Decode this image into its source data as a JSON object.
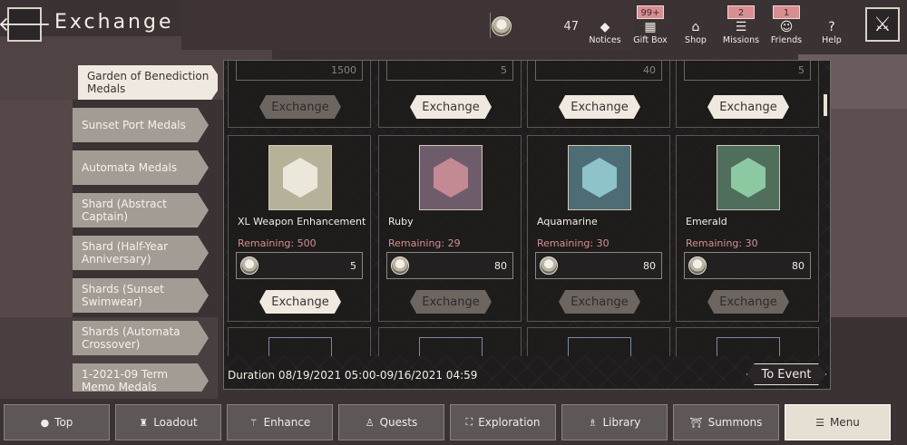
{
  "header": {
    "title": "Exchange",
    "currency_count": "47",
    "nav": [
      {
        "label": "Notices",
        "glyph": "◆",
        "badge": ""
      },
      {
        "label": "Gift Box",
        "glyph": "▦",
        "badge": "99+"
      },
      {
        "label": "Shop",
        "glyph": "⌂",
        "badge": ""
      },
      {
        "label": "Missions",
        "glyph": "☰",
        "badge": "2"
      },
      {
        "label": "Friends",
        "glyph": "☺",
        "badge": "1"
      },
      {
        "label": "Help",
        "glyph": "?",
        "badge": ""
      }
    ]
  },
  "categories": [
    "Garden of Benediction Medals",
    "Sunset Port Medals",
    "Automata Medals",
    "Shard (Abstract Captain)",
    "Shard (Half-Year Anniversary)",
    "Shards (Sunset Swimwear)",
    "Shards (Automata Crossover)",
    "1-2021-09 Term Memo Medals"
  ],
  "partial_row": [
    {
      "cost": "1500",
      "button": "Exchange"
    },
    {
      "cost": "5",
      "button": "Exchange"
    },
    {
      "cost": "40",
      "button": "Exchange"
    },
    {
      "cost": "5",
      "button": "Exchange"
    }
  ],
  "items": [
    {
      "name": "XL Weapon Enhancement",
      "remaining": "Remaining: 500",
      "cost": "5",
      "button": "Exchange",
      "color": "#e9e6dc"
    },
    {
      "name": "Ruby",
      "remaining": "Remaining: 29",
      "cost": "80",
      "button": "Exchange",
      "color": "#c48a94"
    },
    {
      "name": "Aquamarine",
      "remaining": "Remaining: 30",
      "cost": "80",
      "button": "Exchange",
      "color": "#8fc3cc"
    },
    {
      "name": "Emerald",
      "remaining": "Remaining: 30",
      "cost": "80",
      "button": "Exchange",
      "color": "#8cc9a2"
    }
  ],
  "footer": {
    "duration": "Duration 08/19/2021 05:00-09/16/2021 04:59",
    "to_event": "To Event"
  },
  "bottom_nav": [
    {
      "label": "Top",
      "icon": "●"
    },
    {
      "label": "Loadout",
      "icon": "♜"
    },
    {
      "label": "Enhance",
      "icon": "⚚"
    },
    {
      "label": "Quests",
      "icon": "♙"
    },
    {
      "label": "Exploration",
      "icon": "⛶"
    },
    {
      "label": "Library",
      "icon": "♗"
    },
    {
      "label": "Summons",
      "icon": "⛩"
    },
    {
      "label": "Menu",
      "icon": "☰"
    }
  ]
}
